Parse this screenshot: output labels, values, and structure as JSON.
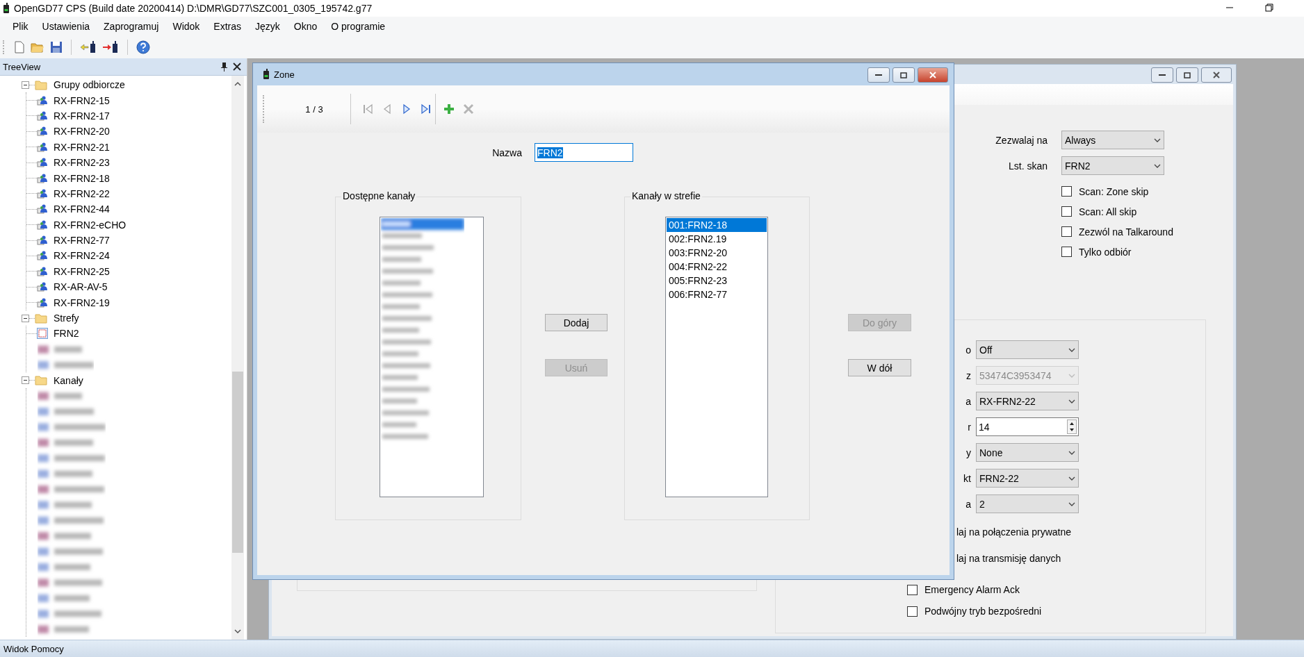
{
  "window": {
    "title": "OpenGD77 CPS (Build date 20200414) D:\\DMR\\GD77\\SZC001_0305_195742.g77"
  },
  "menu": [
    "Plik",
    "Ustawienia",
    "Zaprogramuj",
    "Widok",
    "Extras",
    "Język",
    "Okno",
    "O programie"
  ],
  "tree_panel": {
    "title": "TreeView",
    "items": [
      {
        "label": "Grupy odbiorcze",
        "kind": "folder",
        "expanded": true,
        "children": [
          {
            "label": "RX-FRN2-15",
            "kind": "group"
          },
          {
            "label": "RX-FRN2-17",
            "kind": "group"
          },
          {
            "label": "RX-FRN2-20",
            "kind": "group"
          },
          {
            "label": "RX-FRN2-21",
            "kind": "group"
          },
          {
            "label": "RX-FRN2-23",
            "kind": "group"
          },
          {
            "label": "RX-FRN2-18",
            "kind": "group"
          },
          {
            "label": "RX-FRN2-22",
            "kind": "group"
          },
          {
            "label": "RX-FRN2-44",
            "kind": "group"
          },
          {
            "label": "RX-FRN2-eCHO",
            "kind": "group"
          },
          {
            "label": "RX-FRN2-77",
            "kind": "group"
          },
          {
            "label": "RX-FRN2-24",
            "kind": "group"
          },
          {
            "label": "RX-FRN2-25",
            "kind": "group"
          },
          {
            "label": "RX-AR-AV-5",
            "kind": "group"
          },
          {
            "label": "RX-FRN2-19",
            "kind": "group"
          }
        ]
      },
      {
        "label": "Strefy",
        "kind": "folder",
        "expanded": true,
        "children": [
          {
            "label": "FRN2",
            "kind": "zone"
          }
        ]
      },
      {
        "label": "Kanały",
        "kind": "folder",
        "expanded": true
      }
    ]
  },
  "zone_dialog": {
    "title": "Zone",
    "position": "1 / 3",
    "name_field": {
      "label": "Nazwa",
      "value": "FRN2"
    },
    "available": {
      "title": "Dostępne kanały"
    },
    "in_zone": {
      "title": "Kanały w strefie",
      "items": [
        {
          "label": "001:FRN2-18",
          "selected": true
        },
        {
          "label": "002:FRN2.19",
          "selected": false
        },
        {
          "label": "003:FRN2-20",
          "selected": false
        },
        {
          "label": "004:FRN2-22",
          "selected": false
        },
        {
          "label": "005:FRN2-23",
          "selected": false
        },
        {
          "label": "006:FRN2-77",
          "selected": false
        }
      ]
    },
    "transfer_buttons": [
      {
        "label": "Dodaj",
        "disabled": false
      },
      {
        "label": "Usuń",
        "disabled": true
      }
    ],
    "order_buttons": [
      {
        "label": "Do góry",
        "disabled": true
      },
      {
        "label": "W dół",
        "disabled": false
      }
    ]
  },
  "channel_window": {
    "top_fields": [
      {
        "label": "Zezwalaj na",
        "value": "Always"
      },
      {
        "label": "Lst. skan",
        "value": "FRN2"
      }
    ],
    "top_checks": [
      {
        "label": "Scan: Zone skip",
        "checked": false
      },
      {
        "label": "Scan: All skip",
        "checked": false
      },
      {
        "label": "Zezwól na Talkaround",
        "checked": false
      },
      {
        "label": "Tylko odbiór",
        "checked": false
      }
    ],
    "fields": [
      {
        "label": "o",
        "kind": "combo",
        "value": "Off",
        "disabled": false
      },
      {
        "label": "z",
        "kind": "combo",
        "value": "53474C3953474",
        "disabled": true
      },
      {
        "label": "a",
        "kind": "combo",
        "value": "RX-FRN2-22",
        "disabled": false
      },
      {
        "label": "r",
        "kind": "spin",
        "value": "14",
        "disabled": false
      },
      {
        "label": "y",
        "kind": "combo",
        "value": "None",
        "disabled": false
      },
      {
        "label": "kt",
        "kind": "combo",
        "value": "FRN2-22",
        "disabled": false
      },
      {
        "label": "a",
        "kind": "combo",
        "value": "2",
        "disabled": false
      }
    ],
    "partial_options": [
      "laj na połączenia prywatne",
      "laj na transmisję danych"
    ],
    "checks": [
      {
        "label": "Emergency Alarm Ack",
        "checked": false
      },
      {
        "label": "Podwójny tryb bezpośredni",
        "checked": false
      }
    ]
  },
  "status_bar": "Widok Pomocy"
}
